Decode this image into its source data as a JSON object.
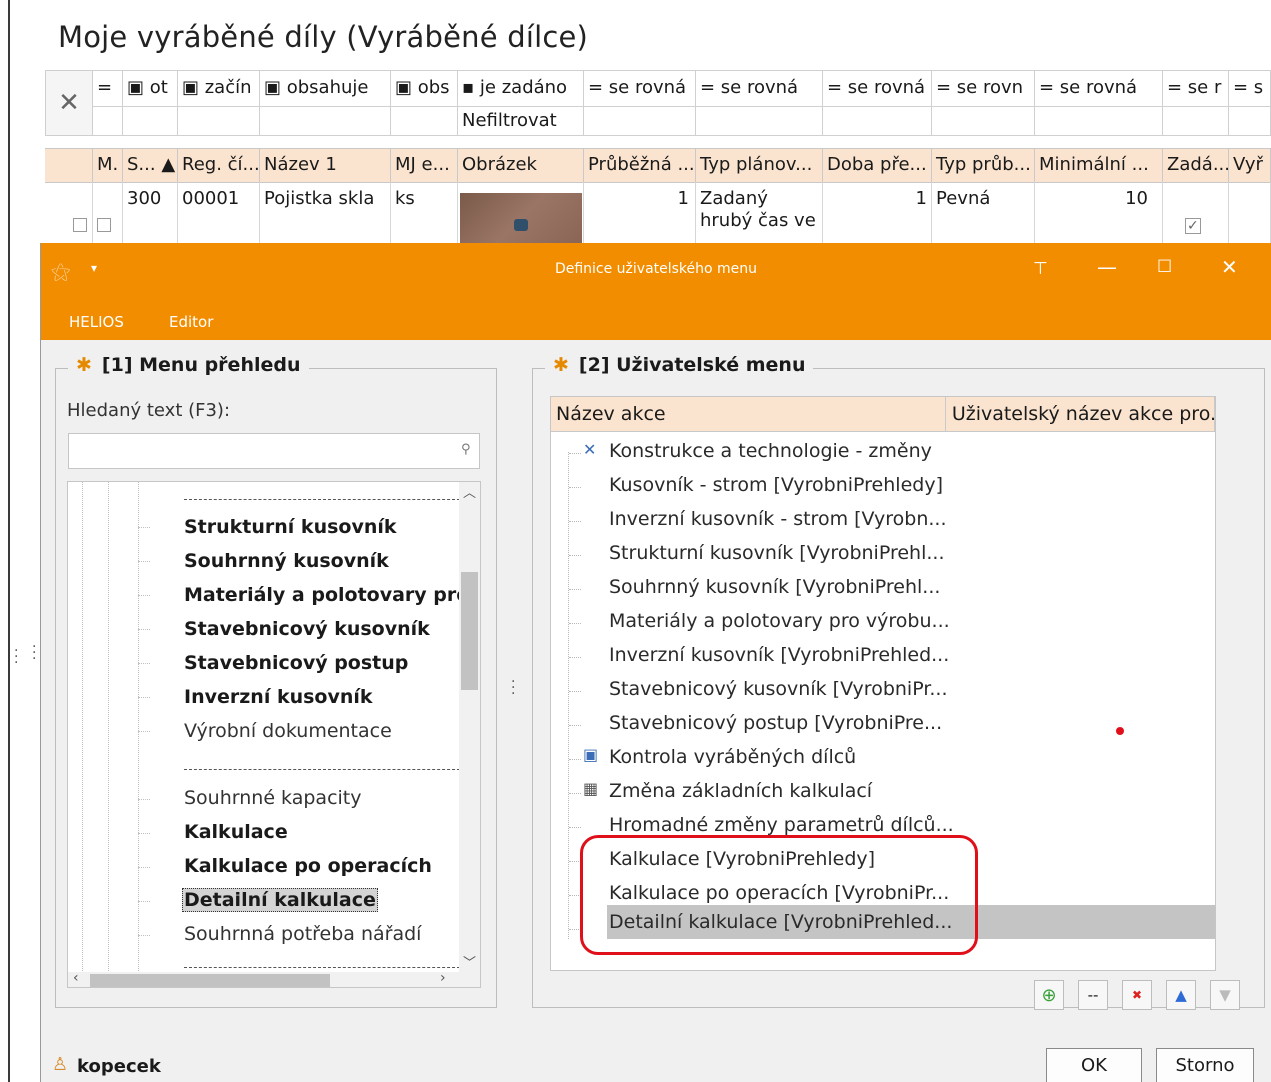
{
  "background": {
    "title": "Moje vyráběné díly (Vyráběné dílce)",
    "clear_filter_icon": "close-icon",
    "filter_row1": [
      "=",
      "▣ ot",
      "▣ začín",
      "▣ obsahuje",
      "▣ obs",
      "▪ je zadáno",
      "= se rovná",
      "= se rovná",
      "= se rovná",
      "= se rovn",
      "= se rovná",
      "= se r",
      "= s"
    ],
    "filter_row2": [
      "",
      "",
      "",
      "",
      "",
      "Nefiltrovat",
      "",
      "",
      "",
      "",
      "",
      "",
      ""
    ],
    "columns": [
      "",
      "M.",
      "S... ▲",
      "Reg. čí...",
      "Název 1",
      "MJ e...",
      "Obrázek",
      "Průběžná ...",
      "Typ plánov...",
      "Doba pře...",
      "Typ průb...",
      "Minimální ...",
      "Zadá...",
      "Vyř"
    ],
    "row": {
      "c1": "300",
      "c2": "00001",
      "c3": "Pojistka skla",
      "c4": "ks",
      "c5": "1",
      "c6": "Zadaný hrubý čas ve",
      "c7": "1",
      "c8": "Pevná",
      "c9": "10"
    }
  },
  "dialog": {
    "title": "Definice uživatelského menu",
    "menu": [
      "HELIOS",
      "Editor"
    ],
    "left": {
      "title": "[1] Menu přehledu",
      "search_label": "Hledaný text (F3):",
      "search_value": "",
      "items": [
        "Strukturní kusovník",
        "Souhrnný kusovník",
        "Materiály a polotovary pro",
        "Stavebnicový kusovník",
        "Stavebnicový postup",
        "Inverzní kusovník",
        "Výrobní dokumentace",
        "Souhrnné kapacity",
        "Kalkulace",
        "Kalkulace po operacích",
        "Detailní kalkulace",
        "Souhrnná potřeba nářadí"
      ]
    },
    "right": {
      "title": "[2] Uživatelské menu",
      "col1": "Název akce",
      "col2": "Uživatelský název akce pro...",
      "items": [
        "Konstrukce a technologie - změny",
        "Kusovník - strom [VyrobniPrehledy]",
        "Inverzní kusovník - strom [Vyrobn...",
        "Strukturní kusovník [VyrobniPrehl...",
        "Souhrnný kusovník [VyrobniPrehl...",
        "Materiály a polotovary pro výrobu...",
        "Inverzní kusovník [VyrobniPrehled...",
        "Stavebnicový kusovník [VyrobniPr...",
        "Stavebnicový postup [VyrobniPre...",
        "Kontrola vyráběných dílců",
        "Změna základních kalkulací",
        "Hromadné změny parametrů dílců...",
        "Kalkulace [VyrobniPrehledy]",
        "Kalkulace po operacích [VyrobniPr...",
        "Detailní kalkulace [VyrobniPrehled..."
      ],
      "toolbar": [
        "⊕",
        "--",
        "✖",
        "▲",
        "▼"
      ]
    },
    "user": "kopecek",
    "ok_label": "OK",
    "cancel_label": "Storno",
    "accent": "#f28d00",
    "highlight": "#e0101a"
  }
}
